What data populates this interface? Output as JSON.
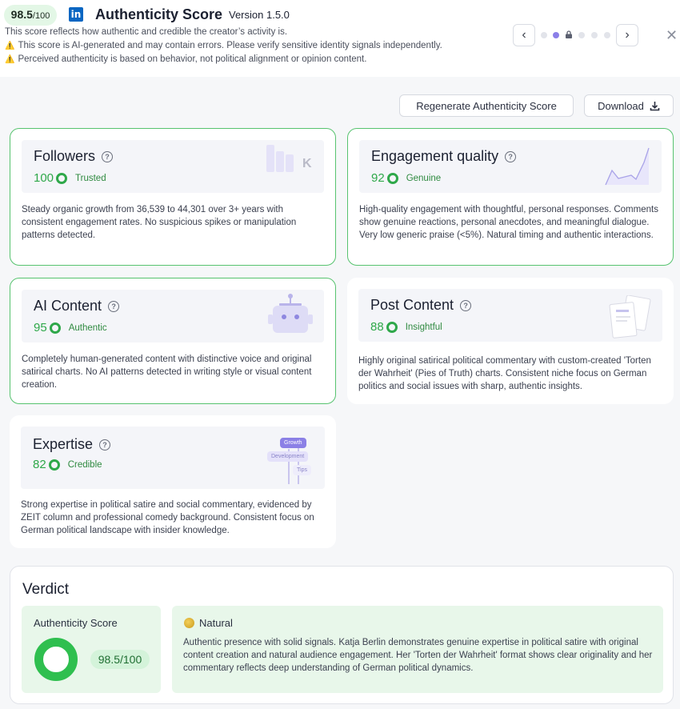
{
  "header": {
    "score_big": "98.5",
    "score_small": "/100",
    "logo_text": "in",
    "title": "Authenticity Score",
    "version": "Version 1.5.0",
    "lines": [
      "This score reflects how authentic and credible the creator’s activity is.",
      "This score is AI-generated and may contain errors. Please verify sensitive identity signals independently.",
      "Perceived authenticity is based on behavior, not political alignment or opinion content."
    ],
    "warn_icon": "⚠️",
    "prev_icon": "‹",
    "next_icon": "›",
    "close_icon": "✕"
  },
  "actions": {
    "regenerate": "Regenerate Authenticity Score",
    "download": "Download"
  },
  "cards": {
    "followers": {
      "title": "Followers",
      "score": "100",
      "label": "Trusted",
      "desc": "Steady organic growth from 36,539 to 44,301 over 3+ years with consistent engagement rates. No suspicious spikes or manipulation patterns detected.",
      "illus_text": "K"
    },
    "engagement": {
      "title": "Engagement quality",
      "score": "92",
      "label": "Genuine",
      "desc": "High-quality engagement with thoughtful, personal responses. Comments show genuine reactions, personal anecdotes, and meaningful dialogue. Very low generic praise (<5%). Natural timing and authentic interactions."
    },
    "ai": {
      "title": "AI Content",
      "score": "95",
      "label": "Authentic",
      "desc": "Completely human-generated content with distinctive voice and original satirical charts. No AI patterns detected in writing style or visual content creation."
    },
    "post": {
      "title": "Post Content",
      "score": "88",
      "label": "Insightful",
      "desc": "Highly original satirical political commentary with custom-created 'Torten der Wahrheit' (Pies of Truth) charts. Consistent niche focus on German politics and social issues with sharp, authentic insights."
    },
    "expertise": {
      "title": "Expertise",
      "score": "82",
      "label": "Credible",
      "desc": "Strong expertise in political satire and social commentary, evidenced by ZEIT column and professional comedy background. Consistent focus on German political landscape with insider knowledge.",
      "tags": [
        "Growth",
        "Development",
        "Tips"
      ]
    }
  },
  "verdict": {
    "title": "Verdict",
    "auth_label": "Authenticity Score",
    "auth_value": "98.5/100",
    "nat_label": "Natural",
    "nat_desc": "Authentic presence with solid signals. Katja Berlin demonstrates genuine expertise in political satire with original content creation and natural audience engagement. Her 'Torten der Wahrheit' format shows clear originality and her commentary reflects deep understanding of German political dynamics."
  },
  "colors": {
    "accent_green": "#2fa84a",
    "brand_linkedin": "#0a66c2",
    "pager_active": "#8b7fe8"
  }
}
